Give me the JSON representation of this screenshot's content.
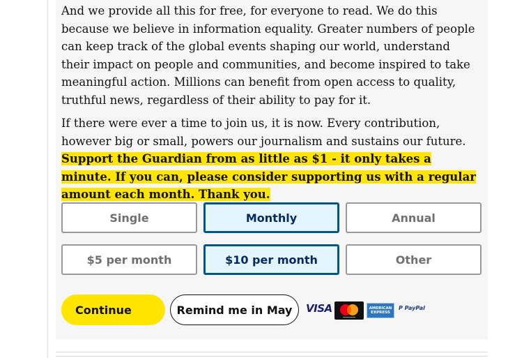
{
  "article": {
    "paragraph1": "And we provide all this for free, for everyone to read. We do this because we believe in information equality. Greater numbers of people can keep track of the global events shaping our world, understand their impact on people and communities, and become inspired to take meaningful action. Millions can benefit from open access to quality, truthful news, regardless of their ability to pay for it.",
    "paragraph2_plain": "If there were ever a time to join us, it is now. Every contribution, however big or small, powers our journalism and sustains our future. ",
    "paragraph2_highlight": "Support the Guardian from as little as $1 - it only takes a minute. If you can, please consider supporting us with a regular amount each month. Thank you."
  },
  "frequency": {
    "options": [
      "Single",
      "Monthly",
      "Annual"
    ],
    "selected": "Monthly"
  },
  "amount": {
    "options": [
      "$5 per month",
      "$10 per month",
      "Other"
    ],
    "selected": "$10 per month"
  },
  "actions": {
    "continue_label": "Continue",
    "remind_label": "Remind me in May"
  },
  "payment_logos": {
    "visa": "VISA",
    "amex": "AMERICAN EXPRESS",
    "paypal_a": "P PayPal"
  },
  "colors": {
    "highlight": "#ffe500",
    "selected_border": "#005689",
    "selected_bg": "#e3f6ff",
    "selected_text": "#052962"
  }
}
